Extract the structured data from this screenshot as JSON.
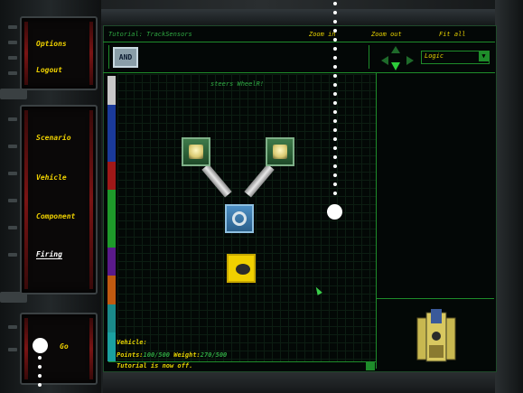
{
  "menu": {
    "options": "Options",
    "logout": "Logout",
    "scenario": "Scenario",
    "vehicle": "Vehicle",
    "component": "Component",
    "firing": "Firing",
    "go": "Go"
  },
  "toolbar": {
    "tutorial_title": "Tutorial: TrackSensors",
    "zoom_in": "Zoom in",
    "zoom_out": "Zoom out",
    "fit_all": "Fit all"
  },
  "logic": {
    "and_button": "AND",
    "dropdown_value": "Logic",
    "dropdown_arrow": "▼",
    "selected_label": "steers WheelR!"
  },
  "status": {
    "vehicle_label": "Vehicle:",
    "points_label": "Points:",
    "points_value": "100/500",
    "weight_label": "Weight:",
    "weight_value": "270/500",
    "message": "Tutorial is now off."
  },
  "palette_colors": [
    "#c8c8c8",
    "#1a3a9a",
    "#1a3a9a",
    "#a01818",
    "#1e9a2a",
    "#1e9a2a",
    "#5a1a8a",
    "#c05a10",
    "#1a8a8a",
    "#1aa0a0"
  ],
  "icons": {
    "sensor": "light-sensor-icon",
    "wheel": "wheel-icon",
    "gun": "gun-icon",
    "vehicle_preview": "tank-vehicle-icon"
  },
  "colors": {
    "accent_yellow": "#e6d200",
    "grid_green": "#1e8c2a",
    "title_green": "#2fa842"
  }
}
